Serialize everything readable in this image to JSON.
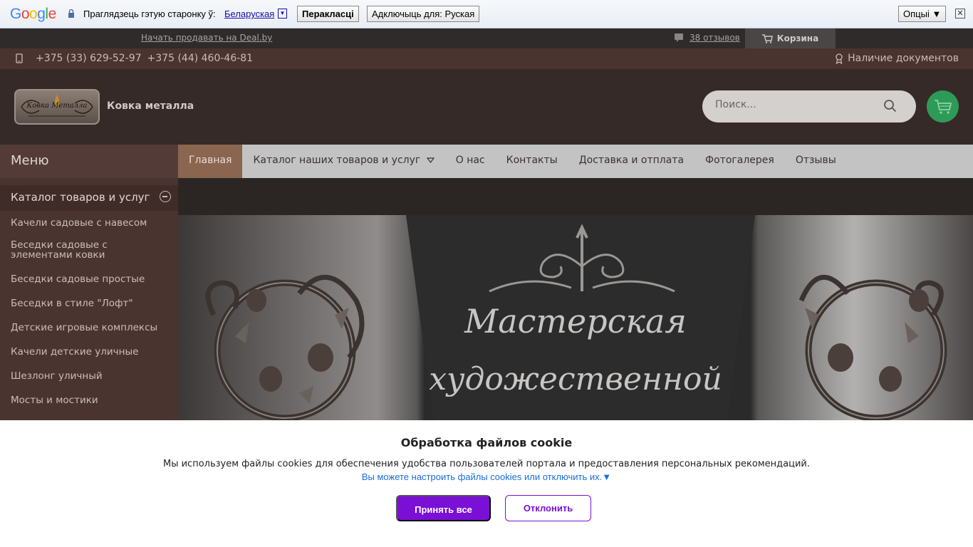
{
  "translate_bar": {
    "logo": "Google",
    "prompt": "Праглядзець гэтую старонку ў:",
    "language": "Беларуская",
    "translate_label": "Перакласці",
    "disable_label": "Адключыць для: Руская",
    "options_label": "Опцыі ▼",
    "close_symbol": "✕"
  },
  "top_strip": {
    "sell_link": "Начать продавать на Deal.by",
    "reviews_link": "38 отзывов",
    "cart_label": "Корзина"
  },
  "contacts": {
    "phone1": "+375 (33) 629-52-97",
    "phone2": "+375 (44) 460-46-81",
    "documents": "Наличие документов"
  },
  "header": {
    "logo_text": "Ковка Металла",
    "site_name": "Ковка металла",
    "search_placeholder": "Поиск..."
  },
  "sidebar": {
    "menu_title": "Меню",
    "catalog_title": "Каталог товаров и услуг",
    "items": [
      "Качели садовые с навесом",
      "Беседки садовые с элементами ковки",
      "Беседки садовые простые",
      "Беседки в стиле \"Лофт\"",
      "Детские игровые комплексы",
      "Качели детские уличные",
      "Шезлонг уличный",
      "Мосты и мостики"
    ]
  },
  "nav": {
    "items": [
      "Главная",
      "Каталог наших товаров и услуг",
      "О нас",
      "Контакты",
      "Доставка и отплата",
      "Фотогалерея",
      "Отзывы"
    ]
  },
  "banner": {
    "line1": "Мастерская",
    "line2": "художественной"
  },
  "cookie": {
    "title": "Обработка файлов cookie",
    "text": "Мы используем файлы cookies для обеспечения удобства пользователей портала и предоставления персональных рекомендаций.",
    "link": "Вы можете настроить файлы cookies или отключить их.▼",
    "accept": "Принять все",
    "decline": "Отклонить"
  }
}
